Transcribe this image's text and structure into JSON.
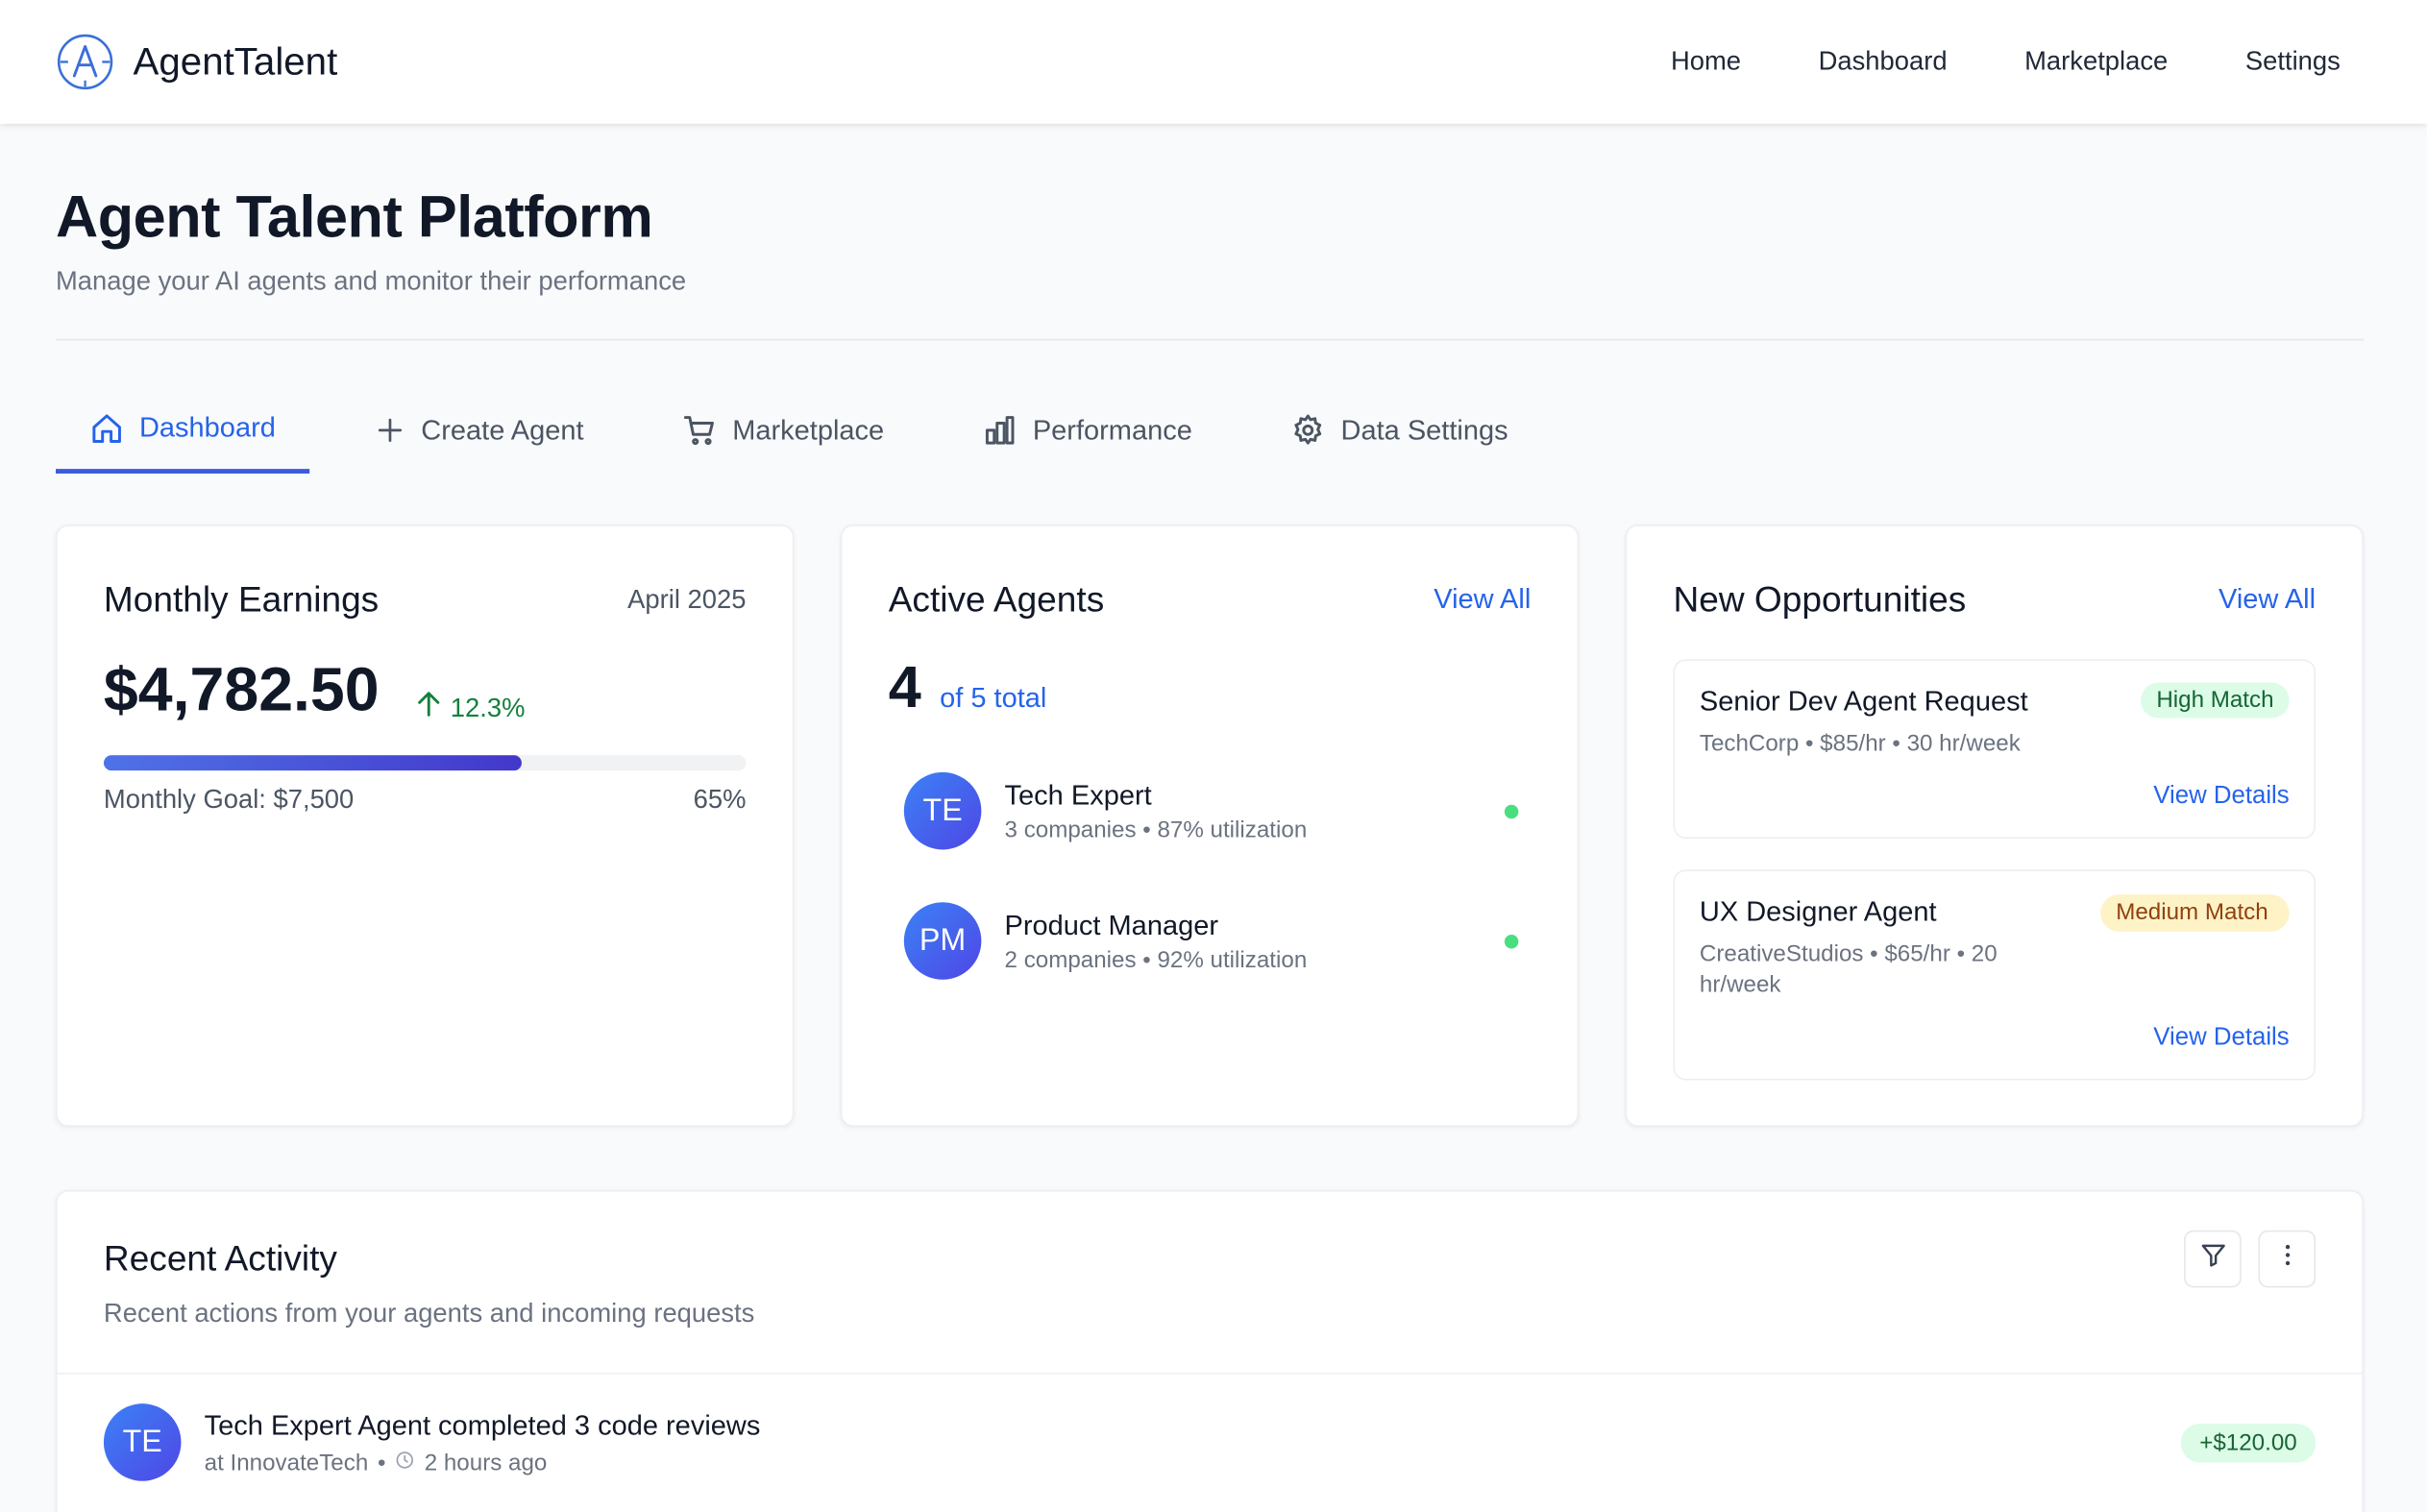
{
  "app": {
    "brand": "AgentTalent",
    "nav": [
      "Home",
      "Dashboard",
      "Marketplace",
      "Settings"
    ]
  },
  "page": {
    "title": "Agent Talent Platform",
    "subtitle": "Manage your AI agents and monitor their performance"
  },
  "tabs": [
    {
      "label": "Dashboard",
      "icon": "home-icon",
      "active": true
    },
    {
      "label": "Create Agent",
      "icon": "plus-icon"
    },
    {
      "label": "Marketplace",
      "icon": "cart-icon"
    },
    {
      "label": "Performance",
      "icon": "bar-chart-icon"
    },
    {
      "label": "Data Settings",
      "icon": "gear-icon"
    }
  ],
  "earnings": {
    "title": "Monthly Earnings",
    "month": "April 2025",
    "amount": "$4,782.50",
    "change": "12.3%",
    "goal_label": "Monthly Goal: $7,500",
    "progress_label": "65%",
    "progress": 0.65
  },
  "agents": {
    "title": "Active Agents",
    "view_all": "View All",
    "count": "4",
    "total": "of 5 total",
    "list": [
      {
        "initials": "TE",
        "name": "Tech Expert",
        "meta": "3 companies • 87% utilization"
      },
      {
        "initials": "PM",
        "name": "Product Manager",
        "meta": "2 companies • 92% utilization"
      }
    ]
  },
  "opportunities": {
    "title": "New Opportunities",
    "view_all": "View All",
    "items": [
      {
        "title": "Senior Dev Agent Request",
        "badge": "High Match",
        "meta": "TechCorp • $85/hr • 30 hr/week",
        "link": "View Details"
      },
      {
        "title": "UX Designer Agent",
        "badge": "Medium Match",
        "meta": "CreativeStudios • $65/hr • 20 hr/week",
        "link": "View Details"
      }
    ]
  },
  "activity": {
    "title": "Recent Activity",
    "subtitle": "Recent actions from your agents and incoming requests",
    "items": [
      {
        "initials": "TE",
        "text": "Tech Expert Agent completed 3 code reviews",
        "company": "at InnovateTech",
        "time": "2 hours ago",
        "amount": "+$120.00"
      }
    ]
  },
  "colors": {
    "accent": "#2563eb",
    "success": "#15803d",
    "avatar_gradient_start": "#3b82f6",
    "avatar_gradient_end": "#4f46e5"
  }
}
